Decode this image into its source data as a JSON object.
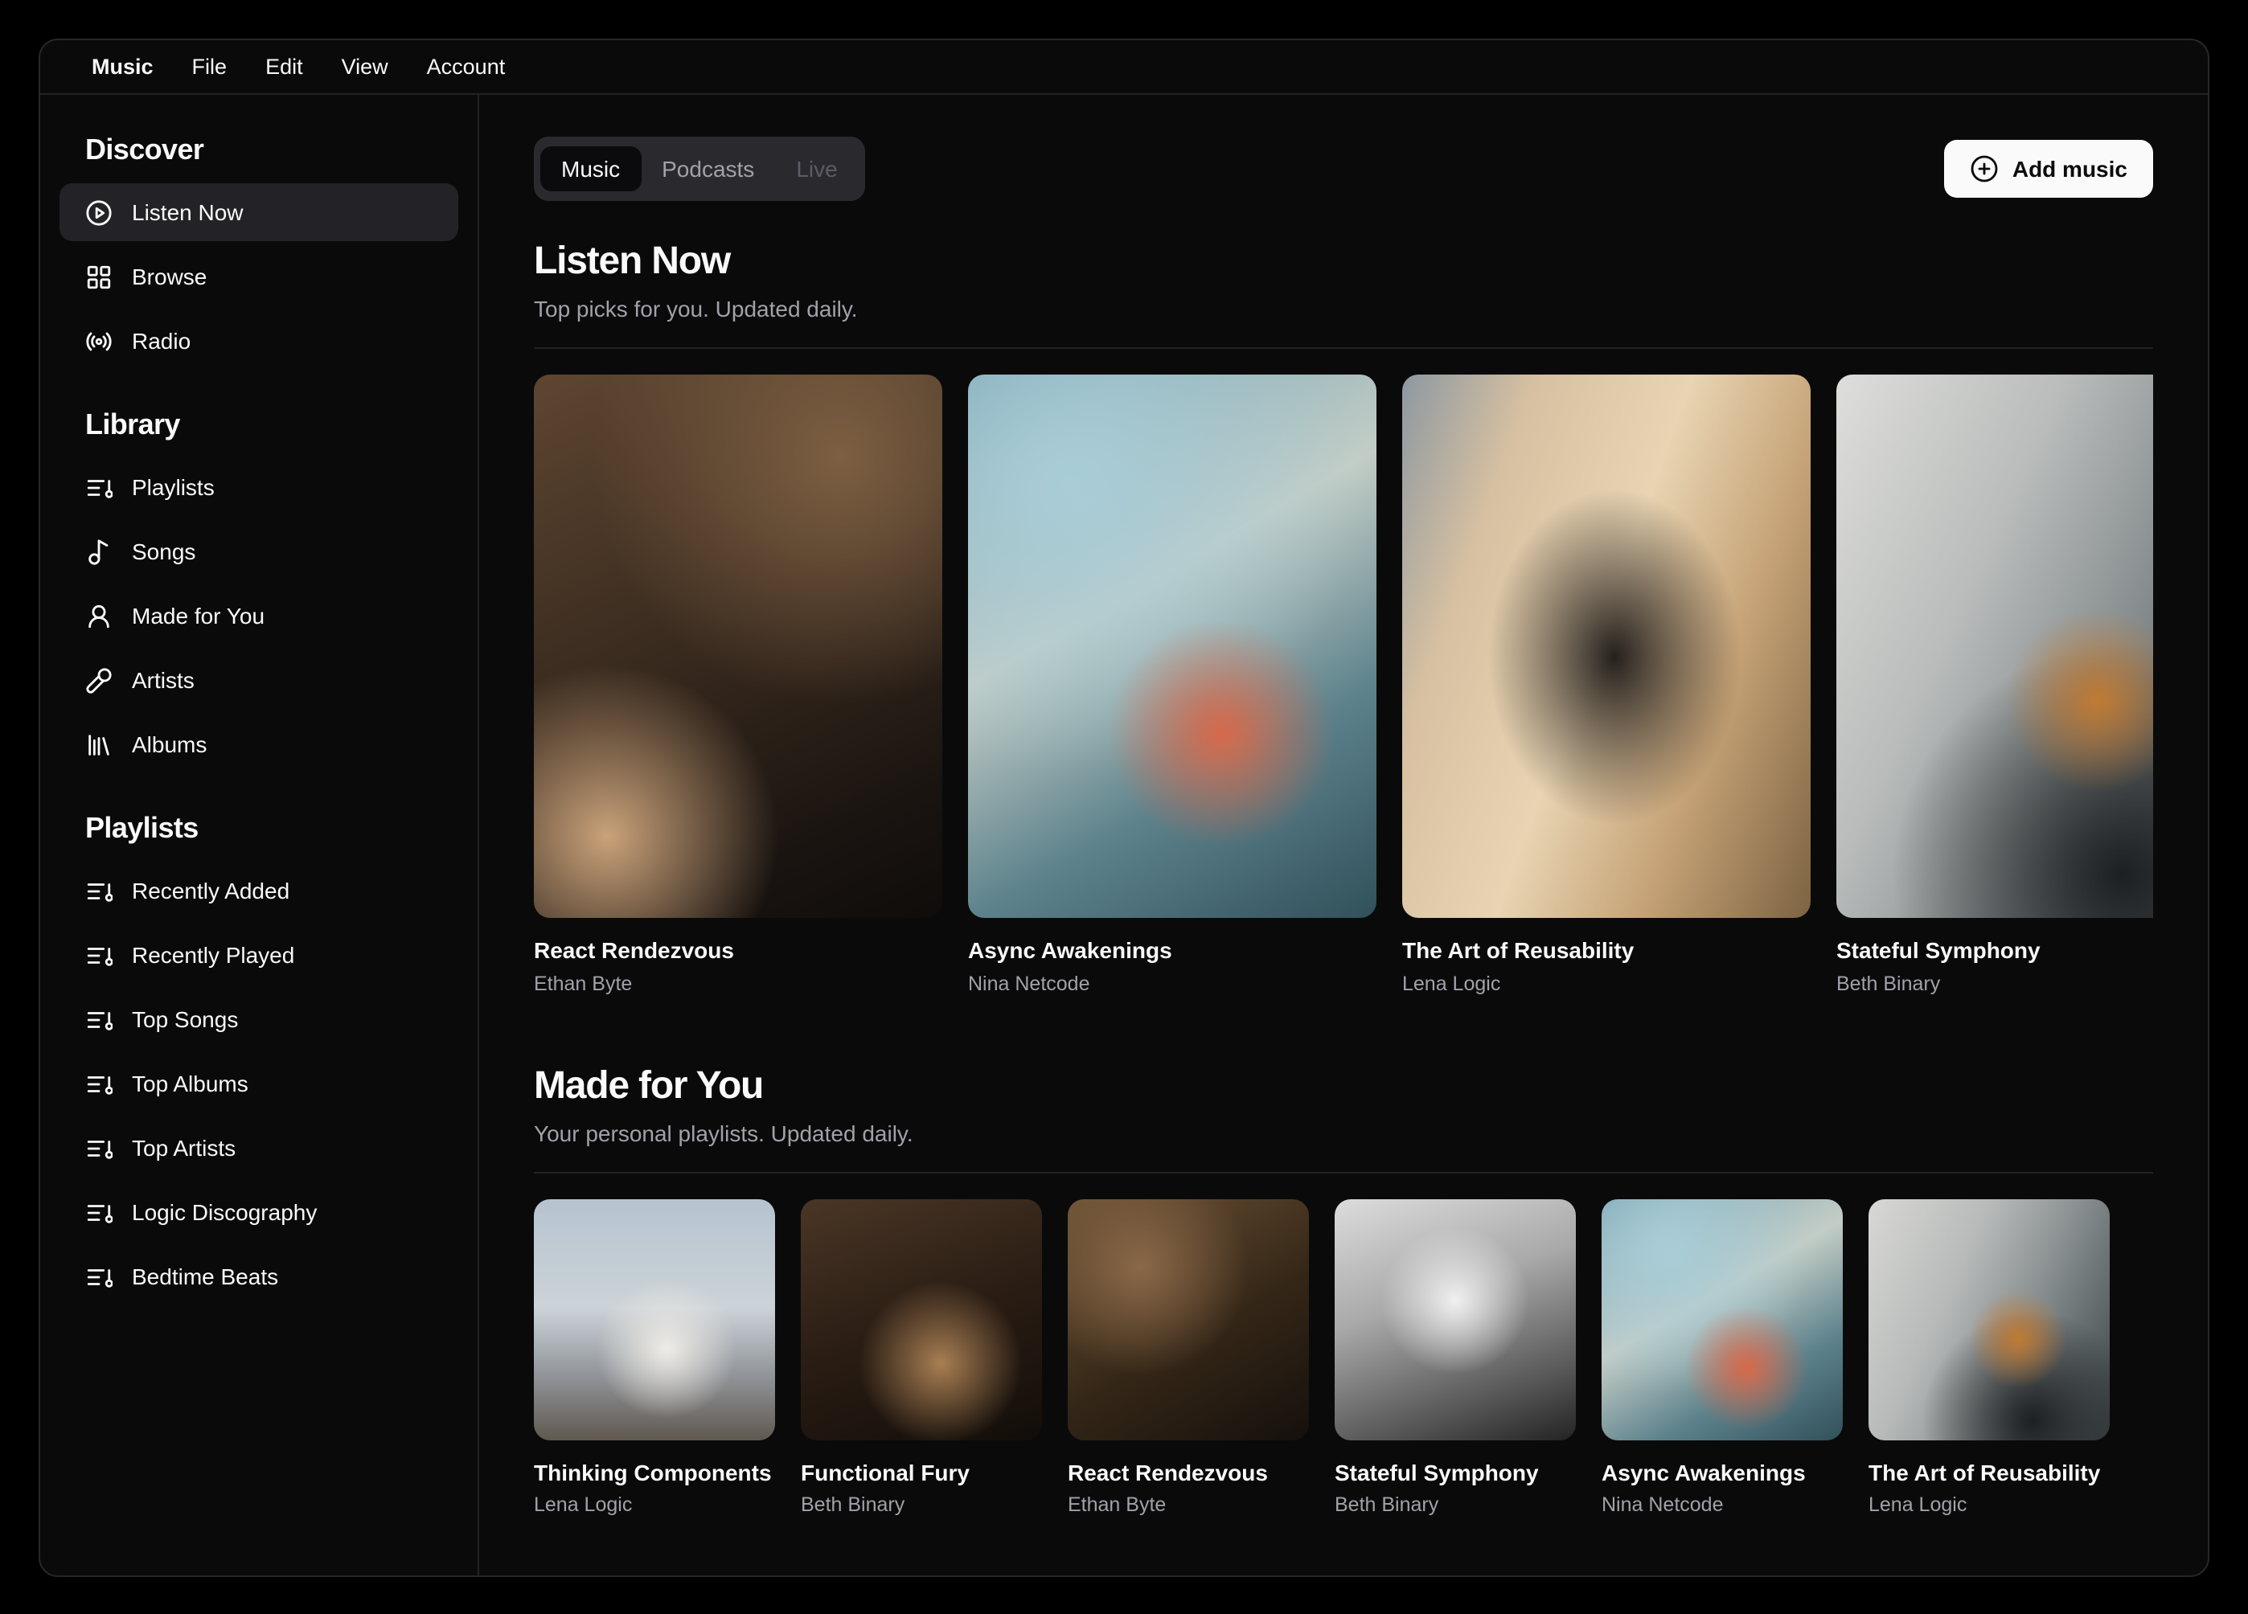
{
  "menubar": {
    "items": [
      "Music",
      "File",
      "Edit",
      "View",
      "Account"
    ]
  },
  "sidebar": {
    "sections": [
      {
        "title": "Discover",
        "items": [
          {
            "label": "Listen Now",
            "icon": "play-circle-icon",
            "active": true
          },
          {
            "label": "Browse",
            "icon": "layout-grid-icon",
            "active": false
          },
          {
            "label": "Radio",
            "icon": "radio-icon",
            "active": false
          }
        ]
      },
      {
        "title": "Library",
        "items": [
          {
            "label": "Playlists",
            "icon": "list-music-icon"
          },
          {
            "label": "Songs",
            "icon": "music-note-icon"
          },
          {
            "label": "Made for You",
            "icon": "user-icon"
          },
          {
            "label": "Artists",
            "icon": "microphone-icon"
          },
          {
            "label": "Albums",
            "icon": "library-icon"
          }
        ]
      },
      {
        "title": "Playlists",
        "items": [
          {
            "label": "Recently Added",
            "icon": "list-music-icon"
          },
          {
            "label": "Recently Played",
            "icon": "list-music-icon"
          },
          {
            "label": "Top Songs",
            "icon": "list-music-icon"
          },
          {
            "label": "Top Albums",
            "icon": "list-music-icon"
          },
          {
            "label": "Top Artists",
            "icon": "list-music-icon"
          },
          {
            "label": "Logic Discography",
            "icon": "list-music-icon"
          },
          {
            "label": "Bedtime Beats",
            "icon": "list-music-icon"
          }
        ]
      }
    ]
  },
  "header": {
    "tabs": [
      {
        "label": "Music",
        "state": "active"
      },
      {
        "label": "Podcasts",
        "state": "default"
      },
      {
        "label": "Live",
        "state": "disabled"
      }
    ],
    "add_button": {
      "label": "Add music",
      "icon": "plus-circle-icon"
    }
  },
  "sections": [
    {
      "title": "Listen Now",
      "subtitle": "Top picks for you. Updated daily.",
      "albums": [
        {
          "title": "React Rendezvous",
          "artist": "Ethan Byte",
          "art_style": "background:radial-gradient(circle at 75% 15%, #7d5f42 0%, rgba(0,0,0,0) 45%),radial-gradient(circle at 18% 85%, #caa27a 0%, rgba(0,0,0,0) 30%),linear-gradient(155deg, #5e4631 0%, #3a2b1f 45%, #1b1511 80%, #0f0c0a 100%)"
        },
        {
          "title": "Async Awakenings",
          "artist": "Nina Netcode",
          "art_style": "background:radial-gradient(circle at 62% 66%, #d7694a 0%, rgba(0,0,0,0) 26%),radial-gradient(circle at 25% 20%, #a9cdd8 0%, rgba(0,0,0,0) 55%),linear-gradient(150deg, #74a0ae 0%, #c3cdc6 40%, #5d828c 70%, #31505a 100%)"
        },
        {
          "title": "The Art of Reusability",
          "artist": "Lena Logic",
          "art_style": "background:radial-gradient(ellipse at 52% 52%, #26211d 0%, rgba(0,0,0,0) 42%),linear-gradient(110deg, #8d98a1 0%, #d6c0a1 22%, #e8d4b2 48%, #c5a276 72%, #7d6342 100%)"
        },
        {
          "title": "Stateful Symphony",
          "artist": "Beth Binary",
          "art_style": "background:radial-gradient(circle at 64% 60%, #c07a33 0%, rgba(0,0,0,0) 22%),radial-gradient(circle at 70% 92%, #1d2022 0%, rgba(0,0,0,0) 40%),linear-gradient(115deg, #dededb 0%, #b9bcbb 35%, #8f9596 58%, #5f6769 82%, #3e4446 100%)"
        }
      ]
    },
    {
      "title": "Made for You",
      "subtitle": "Your personal playlists. Updated daily.",
      "albums": [
        {
          "title": "Thinking Components",
          "artist": "Lena Logic",
          "art_style": "background:radial-gradient(circle at 55% 62%, #efece6 0%, rgba(0,0,0,0) 35%),linear-gradient(180deg, #b6c3cf 0%, #ccd3d8 45%, #93979c 72%, #60584f 100%)"
        },
        {
          "title": "Functional Fury",
          "artist": "Beth Binary",
          "art_style": "background:radial-gradient(circle at 58% 68%, #a87f53 0%, rgba(0,0,0,0) 38%),linear-gradient(160deg, #4a3625 0%, #2a1d14 50%, #120d09 100%)"
        },
        {
          "title": "React Rendezvous",
          "artist": "Ethan Byte",
          "art_style": "background:radial-gradient(circle at 30% 28%, #8a6848 0%, rgba(0,0,0,0) 45%),linear-gradient(150deg, #6d5236 0%, #352717 55%, #15100d 100%)"
        },
        {
          "title": "Stateful Symphony",
          "artist": "Beth Binary",
          "art_style": "background:radial-gradient(circle at 50% 42%, #f0f0f0 0%, rgba(0,0,0,0) 40%),linear-gradient(160deg, #dcdcdc 0%, #a9a9a9 40%, #565656 78%, #232323 100%)"
        },
        {
          "title": "Async Awakenings",
          "artist": "Nina Netcode",
          "art_style": "background:radial-gradient(circle at 60% 70%, #d7694a 0%, rgba(0,0,0,0) 28%),radial-gradient(circle at 28% 22%, #a9cdd8 0%, rgba(0,0,0,0) 55%),linear-gradient(150deg, #74a0ae 0%, #c3cdc6 42%, #5d828c 72%, #31505a 100%)"
        },
        {
          "title": "The Art of Reusability",
          "artist": "Lena Logic",
          "art_style": "background:radial-gradient(circle at 62% 58%, #c07a33 0%, rgba(0,0,0,0) 24%),radial-gradient(circle at 68% 92%, #1d2022 0%, rgba(0,0,0,0) 40%),linear-gradient(115deg, #d8d8d6 0%, #b7bab9 35%, #8e9495 58%, #5d6567 82%, #3c4244 100%)"
        }
      ]
    }
  ],
  "colors": {
    "page_bg": "#000000",
    "panel_bg": "#0a0a0b",
    "border": "#26262b",
    "text": "#fafafa",
    "muted_text": "#a1a1aa",
    "active_item_bg": "#232327",
    "tabs_bg": "#2a2a2e",
    "tab_active_bg": "#0b0b0d",
    "tab_disabled_text": "#5c5c66",
    "add_button_bg": "#fafafa",
    "add_button_text": "#0b0b0d"
  }
}
